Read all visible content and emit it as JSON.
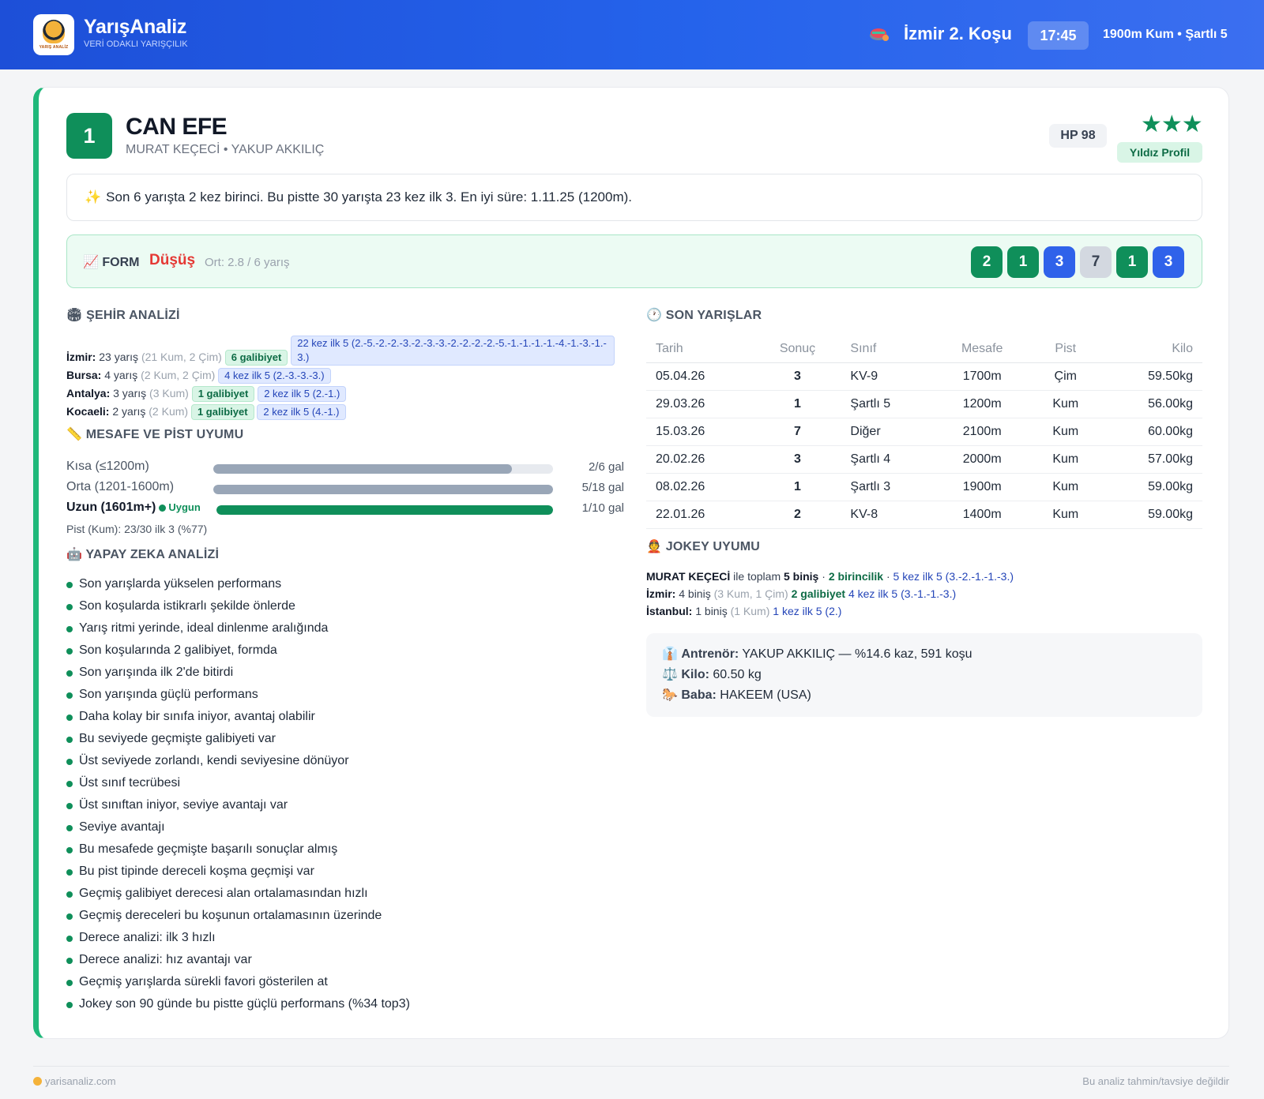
{
  "header": {
    "brand": "YarışAnaliz",
    "tagline": "VERİ ODAKLI YARIŞÇILIK",
    "logo_text": "YARIŞ ANALİZ",
    "race_title": "İzmir 2. Koşu",
    "time": "17:45",
    "race_info": "1900m Kum • Şartlı 5"
  },
  "horse": {
    "number": "1",
    "name": "CAN EFE",
    "persons": "MURAT KEÇECİ • YAKUP AKKILIÇ",
    "hp": "HP 98",
    "stars": "★★★",
    "badge": "Yıldız Profil",
    "summary_icon": "✨",
    "summary": "Son 6 yarışta 2 kez birinci. Bu pistte 30 yarışta 23 kez ilk 3. En iyi süre: 1.11.25 (1200m)."
  },
  "form": {
    "icon": "📈",
    "label": "FORM",
    "trend": "Düşüş",
    "average": "Ort: 2.8 / 6 yarış",
    "chips": [
      {
        "value": "2",
        "kind": "green"
      },
      {
        "value": "1",
        "kind": "green"
      },
      {
        "value": "3",
        "kind": "blue"
      },
      {
        "value": "7",
        "kind": "gray"
      },
      {
        "value": "1",
        "kind": "green"
      },
      {
        "value": "3",
        "kind": "blue"
      }
    ]
  },
  "city": {
    "title": "🏟 ŞEHİR ANALİZİ",
    "rows": [
      {
        "city": "İzmir:",
        "count": "23 yarış",
        "detail": "(21 Kum, 2 Çim)",
        "wins": "6 galibiyet",
        "top5": "22 kez ilk 5 (2.-5.-2.-2.-3.-2.-3.-3.-2.-2.-2.-2.-5.-1.-1.-1.-1.-4.-1.-3.-1.-3.)",
        "long": true
      },
      {
        "city": "Bursa:",
        "count": "4 yarış",
        "detail": "(2 Kum, 2 Çim)",
        "wins": "",
        "top5": "4 kez ilk 5 (2.-3.-3.-3.)",
        "long": false
      },
      {
        "city": "Antalya:",
        "count": "3 yarış",
        "detail": "(3 Kum)",
        "wins": "1 galibiyet",
        "top5": "2 kez ilk 5 (2.-1.)",
        "long": false
      },
      {
        "city": "Kocaeli:",
        "count": "2 yarış",
        "detail": "(2 Kum)",
        "wins": "1 galibiyet",
        "top5": "2 kez ilk 5 (4.-1.)",
        "long": false
      }
    ]
  },
  "distance": {
    "title": "📏 MESAFE VE PİST UYUMU",
    "rows": [
      {
        "label": "Kısa (≤1200m)",
        "value": "2/6 gal",
        "fill": 0.88,
        "strong": false,
        "ok": ""
      },
      {
        "label": "Orta (1201-1600m)",
        "value": "5/18 gal",
        "fill": 1.0,
        "strong": false,
        "ok": ""
      },
      {
        "label": "Uzun (1601m+)",
        "value": "1/10 gal",
        "fill": 1.0,
        "strong": true,
        "ok": "Uygun"
      }
    ],
    "pist": "Pist (Kum): 23/30 ilk 3 (%77)"
  },
  "ai": {
    "title": "🤖 YAPAY ZEKA ANALİZİ",
    "items": [
      "Son yarışlarda yükselen performans",
      "Son koşularda istikrarlı şekilde önlerde",
      "Yarış ritmi yerinde, ideal dinlenme aralığında",
      "Son koşularında 2 galibiyet, formda",
      "Son yarışında ilk 2'de bitirdi",
      "Son yarışında güçlü performans",
      "Daha kolay bir sınıfa iniyor, avantaj olabilir",
      "Bu seviyede geçmişte galibiyeti var",
      "Üst seviyede zorlandı, kendi seviyesine dönüyor",
      "Üst sınıf tecrübesi",
      "Üst sınıftan iniyor, seviye avantajı var",
      "Seviye avantajı",
      "Bu mesafede geçmişte başarılı sonuçlar almış",
      "Bu pist tipinde dereceli koşma geçmişi var",
      "Geçmiş galibiyet derecesi alan ortalamasından hızlı",
      "Geçmiş dereceleri bu koşunun ortalamasının üzerinde",
      "Derece analizi: ilk 3 hızlı",
      "Derece analizi: hız avantajı var",
      "Geçmiş yarışlarda sürekli favori gösterilen at",
      "Jokey son 90 günde bu pistte güçlü performans (%34 top3)"
    ]
  },
  "recent": {
    "title": "🕐 SON YARIŞLAR",
    "headers": [
      "Tarih",
      "Sonuç",
      "Sınıf",
      "Mesafe",
      "Pist",
      "Kilo"
    ],
    "rows": [
      {
        "date": "05.04.26",
        "result": "3",
        "res_color": "orange",
        "class": "KV-9",
        "distance": "1700m",
        "track": "Çim",
        "weight": "59.50kg"
      },
      {
        "date": "29.03.26",
        "result": "1",
        "res_color": "green",
        "class": "Şartlı 5",
        "distance": "1200m",
        "track": "Kum",
        "weight": "56.00kg"
      },
      {
        "date": "15.03.26",
        "result": "7",
        "res_color": "gray",
        "class": "Diğer",
        "distance": "2100m",
        "track": "Kum",
        "weight": "60.00kg"
      },
      {
        "date": "20.02.26",
        "result": "3",
        "res_color": "orange",
        "class": "Şartlı 4",
        "distance": "2000m",
        "track": "Kum",
        "weight": "57.00kg"
      },
      {
        "date": "08.02.26",
        "result": "1",
        "res_color": "green",
        "class": "Şartlı 3",
        "distance": "1900m",
        "track": "Kum",
        "weight": "59.00kg"
      },
      {
        "date": "22.01.26",
        "result": "2",
        "res_color": "orange",
        "class": "KV-8",
        "distance": "1400m",
        "track": "Kum",
        "weight": "59.00kg"
      }
    ]
  },
  "jockey": {
    "title": "👲 JOKEY UYUMU",
    "line1": {
      "name": "MURAT KEÇECİ",
      "text": " ile toplam ",
      "rides": "5 biniş",
      "sep1": " · ",
      "wins": "2 birincilik",
      "sep2": " · ",
      "top5": "5 kez ilk 5 (3.-2.-1.-1.-3.)"
    },
    "line2": {
      "city": "İzmir:",
      "rides": " 4 biniş ",
      "detail": "(3 Kum, 1 Çim)",
      "wins": " 2 galibiyet",
      "top5": " 4 kez ilk 5 (3.-1.-1.-3.)"
    },
    "line3": {
      "city": "İstanbul:",
      "rides": " 1 biniş ",
      "detail": "(1 Kum)",
      "top5": " 1 kez ilk 5 (2.)"
    }
  },
  "info": {
    "trainer_icon": "👔",
    "trainer_label": "Antrenör:",
    "trainer_value": " YAKUP AKKILIÇ — %14.6 kaz, 591 koşu",
    "weight_icon": "⚖️",
    "weight_label": "Kilo:",
    "weight_value": " 60.50 kg",
    "sire_icon": "🐎",
    "sire_label": "Baba:",
    "sire_value": " HAKEEM (USA)"
  },
  "footer": {
    "site": "yarisanaliz.com",
    "disclaimer": "Bu analiz tahmin/tavsiye değildir"
  }
}
